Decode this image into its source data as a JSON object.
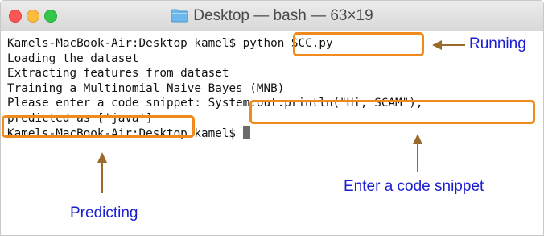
{
  "window": {
    "title": "Desktop — bash — 63×19"
  },
  "terminal": {
    "lines": [
      {
        "prompt": "Kamels-MacBook-Air:Desktop kamel$ ",
        "command": "python SCC.py"
      },
      {
        "text": "Loading the dataset"
      },
      {
        "text": "Extracting features from dataset"
      },
      {
        "text": "Training a Multinomial Naive Bayes (MNB)"
      },
      {
        "prompt": "Please enter a code snippet: ",
        "command": "System.out.println(\"Hi, SCAM\");"
      },
      {
        "text": "predicted as ['java']"
      },
      {
        "prompt": "Kamels-MacBook-Air:Desktop kamel$ "
      }
    ]
  },
  "annotations": {
    "running": "Running",
    "enter_snippet": "Enter a code snippet",
    "predicting": "Predicting"
  },
  "colors": {
    "highlight": "#f08a1c",
    "annotation_text": "#1c1fd0",
    "arrow": "#9a6a2c"
  }
}
